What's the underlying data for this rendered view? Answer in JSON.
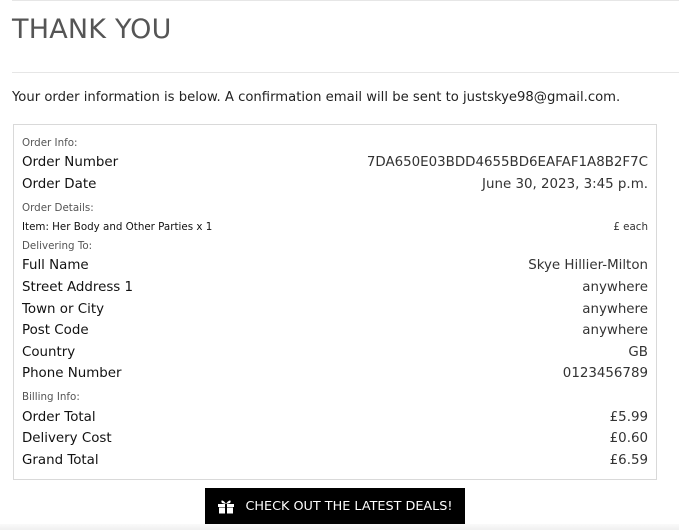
{
  "page": {
    "title": "THANK YOU",
    "intro": "Your order information is below. A confirmation email will be sent to justskye98@gmail.com."
  },
  "order_info": {
    "section_label": "Order Info:",
    "rows": [
      {
        "label": "Order Number",
        "value": "7DA650E03BDD4655BD6EAFAF1A8B2F7C"
      },
      {
        "label": "Order Date",
        "value": "June 30, 2023, 3:45 p.m."
      }
    ]
  },
  "order_details": {
    "section_label": "Order Details:",
    "item": {
      "label": "Item: Her Body and Other Parties x 1",
      "price": "£ each"
    }
  },
  "delivery": {
    "section_label": "Delivering To:",
    "rows": [
      {
        "label": "Full Name",
        "value": "Skye Hillier-Milton"
      },
      {
        "label": "Street Address 1",
        "value": "anywhere"
      },
      {
        "label": "Town or City",
        "value": "anywhere"
      },
      {
        "label": "Post Code",
        "value": "anywhere"
      },
      {
        "label": "Country",
        "value": "GB"
      },
      {
        "label": "Phone Number",
        "value": "0123456789"
      }
    ]
  },
  "billing": {
    "section_label": "Billing Info:",
    "rows": [
      {
        "label": "Order Total",
        "value": "£5.99"
      },
      {
        "label": "Delivery Cost",
        "value": "£0.60"
      },
      {
        "label": "Grand Total",
        "value": "£6.59"
      }
    ]
  },
  "cta": {
    "label": "CHECK OUT THE LATEST DEALS!",
    "icon": "gift-icon",
    "background": "#000000",
    "color": "#ffffff"
  }
}
